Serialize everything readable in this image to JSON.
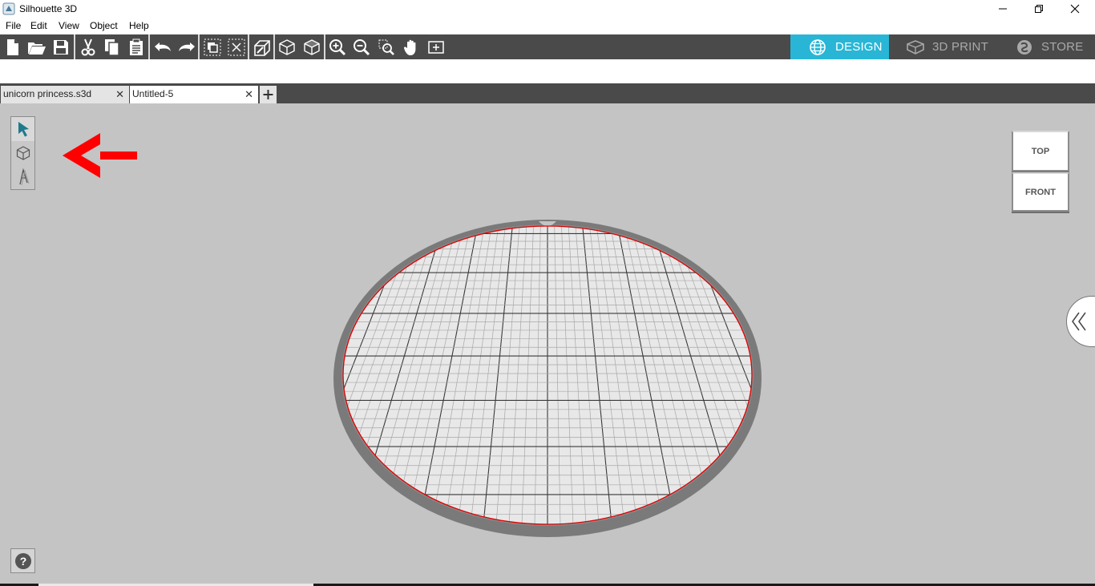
{
  "window": {
    "title": "Silhouette 3D"
  },
  "menu": [
    "File",
    "Edit",
    "View",
    "Object",
    "Help"
  ],
  "toolbar": {
    "icons": [
      "new-file-icon",
      "open-folder-icon",
      "save-icon",
      "cut-icon",
      "copy-icon",
      "paste-icon",
      "undo-icon",
      "redo-icon",
      "group-icon",
      "ungroup-icon",
      "extrude-icon",
      "cube-outline-icon",
      "cube-icon",
      "zoom-in-icon",
      "zoom-out-icon",
      "zoom-selection-icon",
      "pan-hand-icon",
      "fit-page-icon"
    ]
  },
  "modes": {
    "design": "DESIGN",
    "print": "3D PRINT",
    "store": "STORE",
    "active": "design"
  },
  "tabs": [
    {
      "label": "unicorn princess.s3d",
      "active": false
    },
    {
      "label": "Untitled-5",
      "active": true
    }
  ],
  "view_cube": {
    "top": "TOP",
    "front": "FRONT"
  },
  "help": {
    "label": "?"
  },
  "colors": {
    "accent": "#29b6d6",
    "toolbar": "#4a4a4a",
    "canvas": "#c4c4c4",
    "annotation_arrow": "#ff0000",
    "plate_edge": "#e00000"
  }
}
